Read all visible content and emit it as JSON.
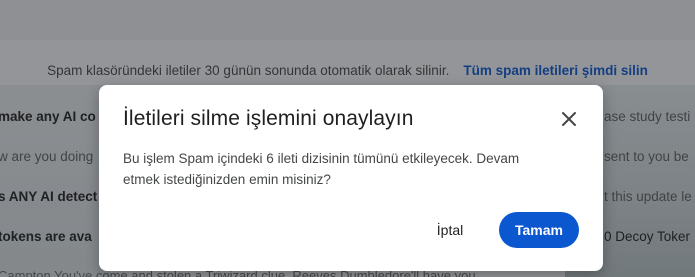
{
  "spam_banner": {
    "notice": "Spam klasöründeki iletiler 30 günün sonunda otomatik olarak silinir.",
    "action": "Tüm spam iletileri şimdi silin"
  },
  "mail_rows": [
    {
      "subject": "make any AI co",
      "snippet": "ase study testi"
    },
    {
      "subject": "w are you doing",
      "snippet": "sent to you be"
    },
    {
      "subject": "s ANY AI detect",
      "snippet": "t this update le"
    },
    {
      "subject": "tokens are ava",
      "snippet": "0 Decoy Toker"
    },
    {
      "subject": "Campton You've come and stolen a Triwizard clue. Reeves Dumbledore'll have you"
    }
  ],
  "dialog": {
    "title": "İletileri silme işlemini onaylayın",
    "body": "Bu işlem Spam içindeki 6 ileti dizisinin tümünü etkileyecek. Devam etmek istediğinizden emin misiniz?",
    "cancel_label": "İptal",
    "ok_label": "Tamam",
    "close_icon": "close-icon"
  },
  "colors": {
    "accent": "#0b57d0",
    "text": "#1f1f1f",
    "scrim": "rgba(32,33,36,0.45)"
  }
}
